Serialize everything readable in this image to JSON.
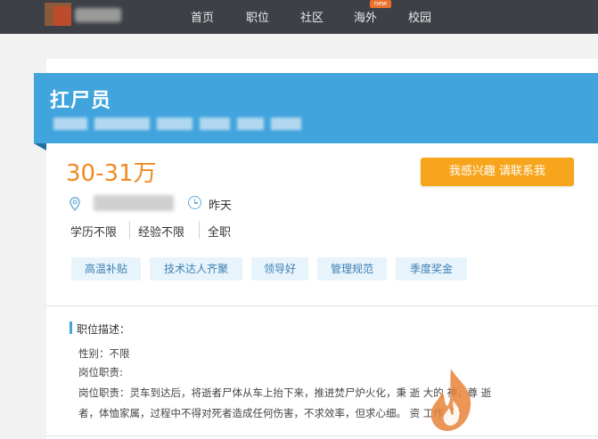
{
  "nav": {
    "items": [
      "首页",
      "职位",
      "社区",
      "海外",
      "校园"
    ],
    "new_badge": "new"
  },
  "job": {
    "title": "扛尸员",
    "salary": "30-31万",
    "posted": "昨天",
    "apply_label": "我感兴趣 请联系我",
    "requirements": [
      "学历不限",
      "经验不限",
      "全职"
    ],
    "tags": [
      "高温补贴",
      "技术达人齐聚",
      "领导好",
      "管理规范",
      "季度奖金"
    ]
  },
  "description": {
    "title": "职位描述：",
    "lines": [
      "性别：不限",
      "岗位职责:",
      "岗位职责：灵车到达后，将逝者尸体从车上抬下来，推进焚尸炉火化，秉    逝    大的    神，尊    逝",
      "者，体恤家属，过程中不得对死者造成任何伤害，不求效率，但求心细。    资    工作    间："
    ]
  },
  "colors": {
    "nav_bg": "#3d4147",
    "banner": "#41a4dd",
    "salary": "#f08a24",
    "button": "#f7a51c",
    "tag_bg": "#e8f4fb",
    "tag_text": "#3c7fb4",
    "watermark": "#e8833a"
  },
  "icons": {
    "location": "location-pin-icon",
    "time": "clock-icon",
    "watermark": "flame-logo-icon"
  }
}
